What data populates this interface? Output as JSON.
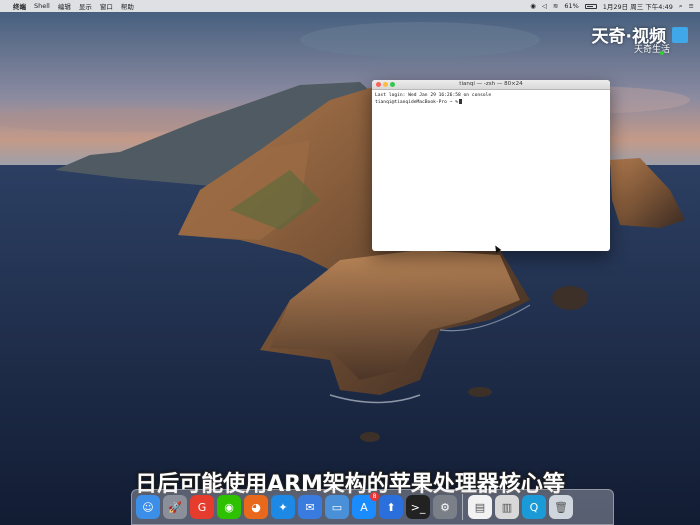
{
  "menubar": {
    "apple_glyph": "",
    "items": [
      "终端",
      "Shell",
      "编辑",
      "显示",
      "窗口",
      "帮助"
    ],
    "battery_percent": "61%",
    "clock": "1月29日 周三 下午4:49"
  },
  "watermark": {
    "main": "天奇·视频",
    "sub": "天奇生活"
  },
  "terminal": {
    "title": "tianqi — -zsh — 80×24",
    "lines": [
      "Last login: Wed Jan 29 16:26:58 on console",
      "tianqi@tianqideMacBook-Pro ~ %"
    ]
  },
  "subtitle": "日后可能使用ARM架构的苹果处理器核心等",
  "dock": {
    "apps": [
      {
        "name": "finder",
        "bg": "#3b8fe8",
        "glyph": "☺"
      },
      {
        "name": "launchpad",
        "bg": "#8a8f99",
        "glyph": "🚀"
      },
      {
        "name": "app-g",
        "bg": "#e63c2e",
        "glyph": "G"
      },
      {
        "name": "wechat",
        "bg": "#2dc100",
        "glyph": "◉"
      },
      {
        "name": "firefox",
        "bg": "#e8691c",
        "glyph": "◕"
      },
      {
        "name": "safari",
        "bg": "#1e88e5",
        "glyph": "✦"
      },
      {
        "name": "mail",
        "bg": "#3a7be0",
        "glyph": "✉"
      },
      {
        "name": "folder",
        "bg": "#4a90d9",
        "glyph": "▭"
      },
      {
        "name": "app-store",
        "bg": "#1a8cff",
        "glyph": "A",
        "badge": "8"
      },
      {
        "name": "upload",
        "bg": "#2a6fdb",
        "glyph": "⬆"
      },
      {
        "name": "terminal",
        "bg": "#222222",
        "glyph": ">_"
      },
      {
        "name": "system-preferences",
        "bg": "#7a7f88",
        "glyph": "⚙"
      }
    ],
    "right_items": [
      {
        "name": "document",
        "bg": "#f2f2f2",
        "glyph": "▤"
      },
      {
        "name": "archive",
        "bg": "#d8d8d8",
        "glyph": "▥"
      },
      {
        "name": "quicktime",
        "bg": "#1a9bd8",
        "glyph": "Q"
      },
      {
        "name": "trash",
        "bg": "#cfd6dd",
        "glyph": "🗑"
      }
    ]
  }
}
